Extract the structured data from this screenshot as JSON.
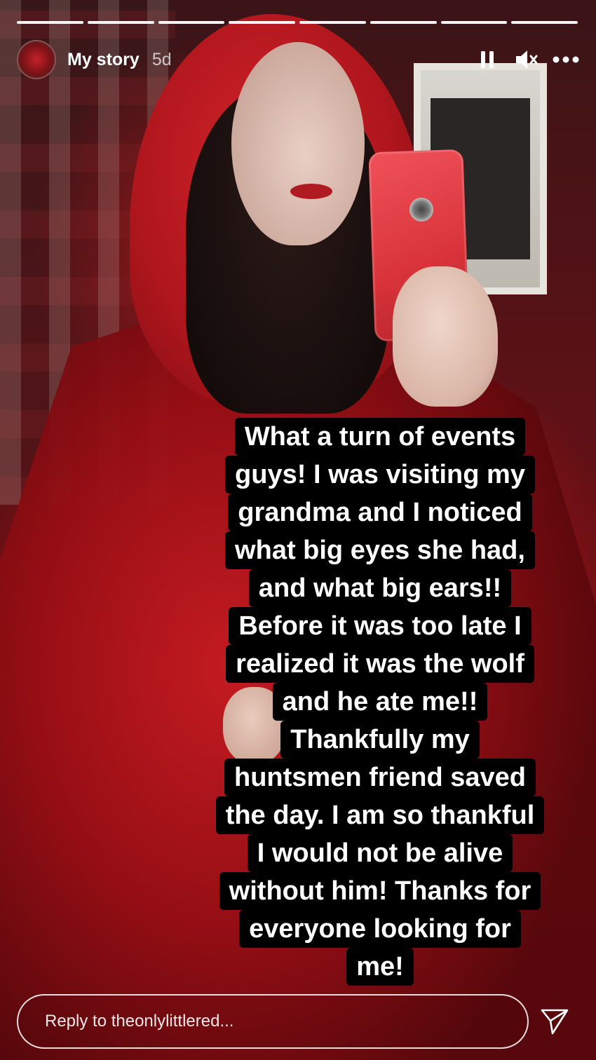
{
  "story": {
    "progress_segments": 8,
    "username": "My story",
    "time_ago": "5d",
    "actions": {
      "pause_icon": "pause-icon",
      "mute_icon": "muted-speaker-icon",
      "more_icon": "more-options-icon"
    },
    "caption_lines": [
      "What a turn of events",
      "guys! I was visiting my",
      "grandma and I noticed",
      "what big eyes she had,",
      "and what big ears!!",
      "Before it was too late I",
      "realized it was the wolf",
      "and he ate me!!",
      "Thankfully my",
      "huntsmen friend saved",
      "the day. I am so thankful",
      "I would not be alive",
      "without him! Thanks for",
      "everyone looking for",
      "me!"
    ]
  },
  "reply": {
    "placeholder": "Reply to theonlylittlered...",
    "send_icon": "send-icon"
  },
  "colors": {
    "text": "#ffffff",
    "caption_bg": "#000000",
    "accent_red": "#c42128"
  }
}
